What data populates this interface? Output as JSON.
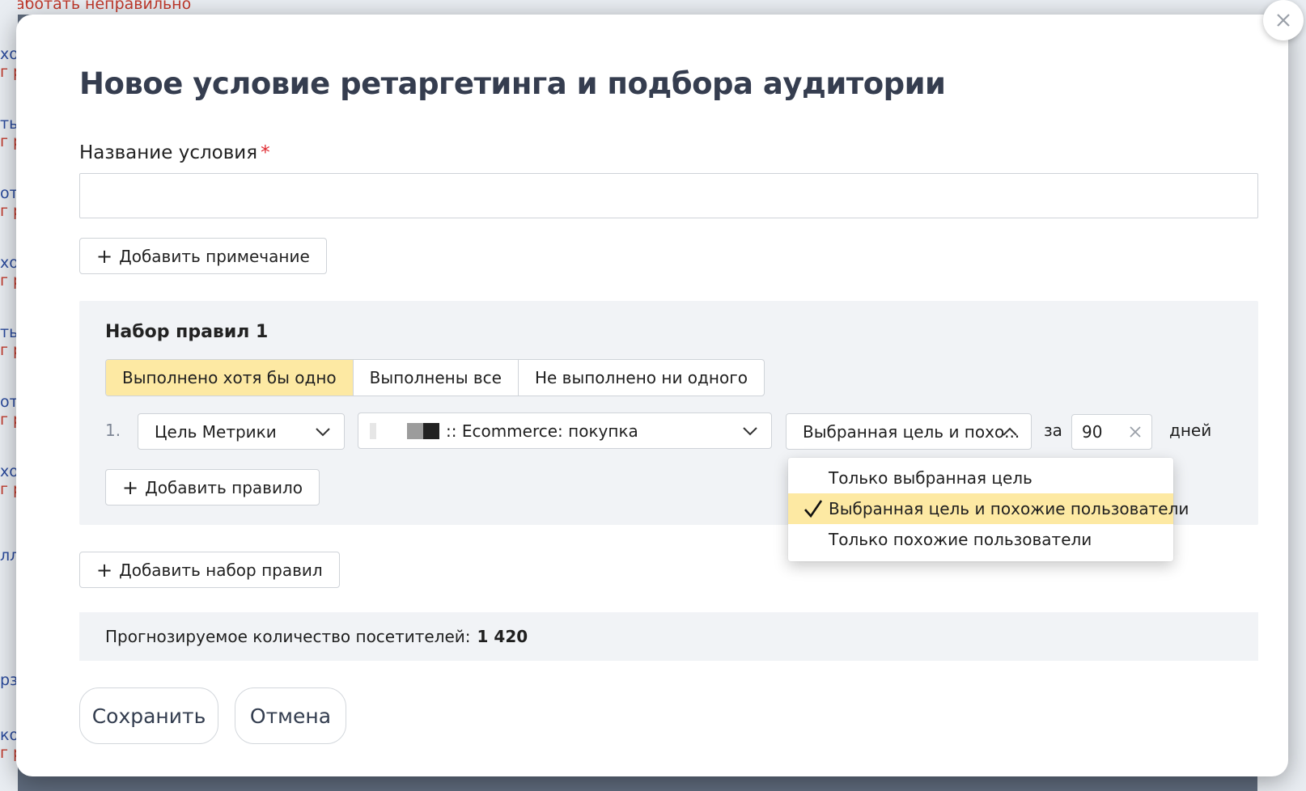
{
  "background": {
    "top_text": "работать неправильно",
    "left_fragments": [
      {
        "a": "хо",
        "b": "г р"
      },
      {
        "a": "ты",
        "b": "г р"
      },
      {
        "a": "от",
        "b": "г р"
      },
      {
        "a": "хо",
        "b": "г р"
      },
      {
        "a": "ты",
        "b": "г р"
      },
      {
        "a": "от",
        "b": "г р"
      },
      {
        "a": "хо",
        "b": "г р"
      },
      {
        "a": "лл",
        "b": ""
      },
      {
        "a": "рз",
        "b": ""
      },
      {
        "a": "ко",
        "b": "г р"
      }
    ]
  },
  "modal": {
    "title": "Новое условие ретаргетинга и подбора аудитории",
    "name_label": "Название условия",
    "required_mark": "*",
    "name_value": "",
    "add_note_label": "Добавить примечание",
    "ruleset": {
      "title": "Набор правил 1",
      "modes": [
        "Выполнено хотя бы одно",
        "Выполнены все",
        "Не выполнено ни одного"
      ],
      "active_mode": "Выполнено хотя бы одно",
      "rule": {
        "number": "1.",
        "type_select": "Цель Метрики",
        "goal_select": ":: Ecommerce: покупка",
        "audience_select": "Выбранная цель и похо...",
        "period_prefix": "за",
        "days_value": "90",
        "period_suffix": "дней"
      },
      "add_rule_label": "Добавить правило"
    },
    "audience_options": [
      {
        "label": "Только выбранная цель",
        "selected": false
      },
      {
        "label": "Выбранная цель и похожие пользователи",
        "selected": true
      },
      {
        "label": "Только похожие пользователи",
        "selected": false
      }
    ],
    "add_ruleset_label": "Добавить набор правил",
    "forecast_label": "Прогнозируемое количество посетителей:",
    "forecast_value": "1 420",
    "save_label": "Сохранить",
    "cancel_label": "Отмена"
  },
  "colors": {
    "accent_yellow": "#fde9a3",
    "required_red": "#e0282f",
    "title_color": "#353d4f",
    "panel_gray": "#f1f3f6"
  },
  "icons": [
    "close-icon",
    "plus-icon",
    "chevron-down-icon",
    "chevron-up-icon",
    "clear-icon",
    "check-icon"
  ]
}
